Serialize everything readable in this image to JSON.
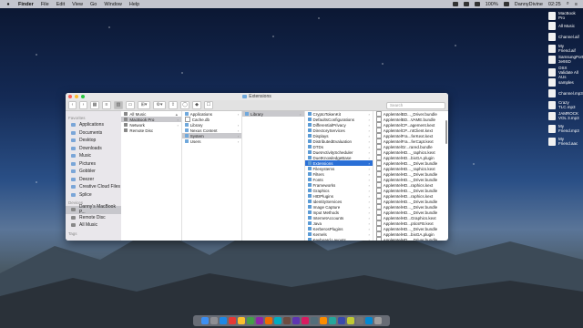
{
  "menubar": {
    "app": "Finder",
    "items": [
      "File",
      "Edit",
      "View",
      "Go",
      "Window",
      "Help"
    ],
    "battery": "100%",
    "user": "DannyDivine",
    "clock": "02:25"
  },
  "window": {
    "title": "Extensions",
    "search_placeholder": "Search"
  },
  "sidebar": {
    "favorites_header": "Favorites",
    "favorites": [
      "Applications",
      "Documents",
      "Desktop",
      "Downloads",
      "Music",
      "Pictures",
      "Gobbler",
      "Deezer",
      "Creative Cloud Files",
      "Splice"
    ],
    "devices_header": "Devices",
    "devices": [
      "Danny's MacBook P...",
      "Remote Disc",
      "All Music"
    ],
    "tags_header": "Tags"
  },
  "columns": {
    "col1": [
      "All Music",
      "MacBook Pro",
      "Network",
      "Remote Disc"
    ],
    "col2": [
      "Applications",
      "Cache.db",
      "Library",
      "Nexus Content",
      "System",
      "Users"
    ],
    "col3": [
      "Library"
    ],
    "col4": [
      "CryptoTokenKit",
      "DefaultsConfigurations",
      "DifferentialPrivacy",
      "DirectoryServices",
      "Displays",
      "DistributedEvaluation",
      "DTDs",
      "DuetActivityScheduler",
      "DuetKnowledgeBase",
      "Extensions",
      "Filesystems",
      "Filters",
      "Fonts",
      "Frameworks",
      "Graphics",
      "HIDPlugins",
      "IdentityServices",
      "Image Capture",
      "Input Methods",
      "InternetAccounts",
      "Java",
      "KerberosPlugins",
      "Kernels",
      "Keyboard Layouts"
    ],
    "col5": [
      "AppleIntelBD..._Driver.bundle",
      "AppleIntelBD...VAME.bundle",
      "AppleIntelCP...agement.kext",
      "AppleIntelCP...ntClient.kext",
      "AppleIntelFra...ferKext.kext",
      "AppleIntelFra...ferCapt.kext",
      "AppleIntelGr...rared.bundle",
      "AppleIntelHD..._raphics.kext",
      "AppleIntelHD...bixGA.plugin",
      "AppleIntelHD..._Driver.bundle",
      "AppleIntelHD..._raphics.kext",
      "AppleIntelHD..._Driver.bundle",
      "AppleIntelHD..._Driver.bundle",
      "AppleIntelHD...raphics.kext",
      "AppleIntelHD..._Driver.bundle",
      "AppleIntelHD...raphics.kext",
      "AppleIntelHD..._Driver.bundle",
      "AppleIntelHD..._Driver.bundle",
      "AppleIntelHD..._Driver.bundle",
      "AppleIntelHD...Graphics.kext",
      "AppleIntelHD...pticsFB.kext",
      "AppleIntelHD..._Driver.bundle",
      "AppleIntelHD...bixGA.plugin",
      "AppleIntelHD..._Driver.bundle"
    ]
  },
  "desktop_icons": [
    "MacBook Pro",
    "All Music",
    "Channel.aif",
    "My Friend.aif",
    "SamsungPorts 3e9SD",
    "OSX Validate All AUs",
    "samples",
    "Channel.mp3",
    "Crazy TLC.mp3",
    "JAMROCK VOL 3.mp3",
    "My Friend.mp3",
    "My Friend.aac"
  ]
}
